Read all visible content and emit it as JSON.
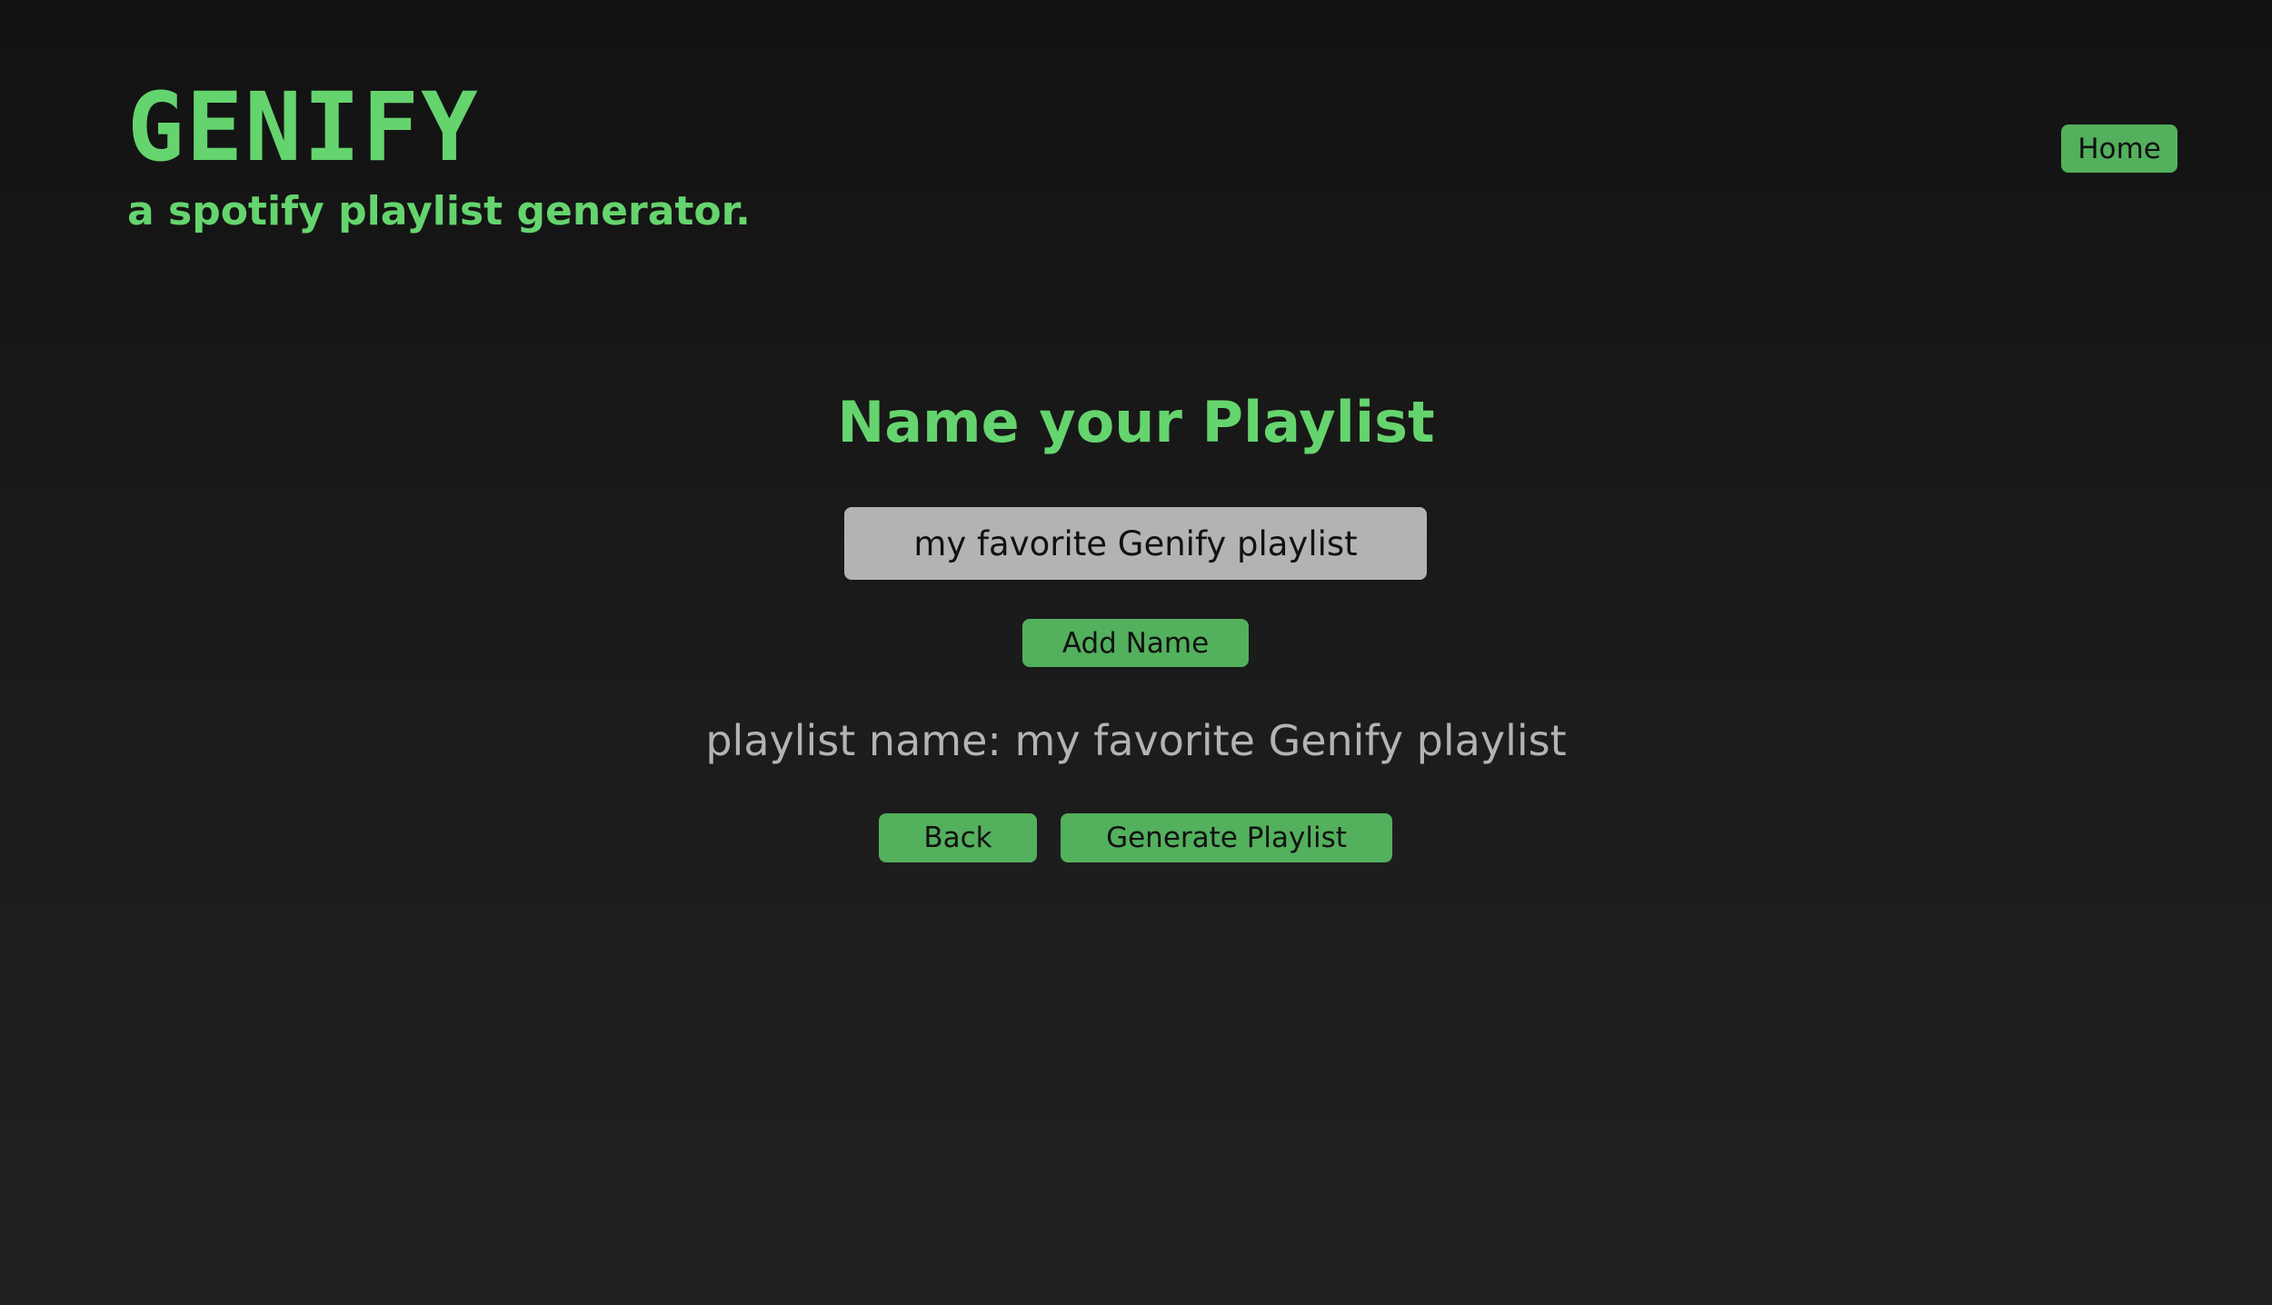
{
  "header": {
    "logo": "GENIFY",
    "tagline": "a spotify playlist generator.",
    "home_label": "Home"
  },
  "main": {
    "heading": "Name your Playlist",
    "input_value": "my favorite Genify playlist",
    "add_name_label": "Add Name",
    "playlist_name_text": "playlist name: my favorite Genify playlist",
    "back_label": "Back",
    "generate_label": "Generate Playlist"
  },
  "colors": {
    "accent_text": "#65d46e",
    "button_bg": "#53b05d",
    "input_bg": "#b3b3b3",
    "muted_text": "#b3b3b3"
  }
}
